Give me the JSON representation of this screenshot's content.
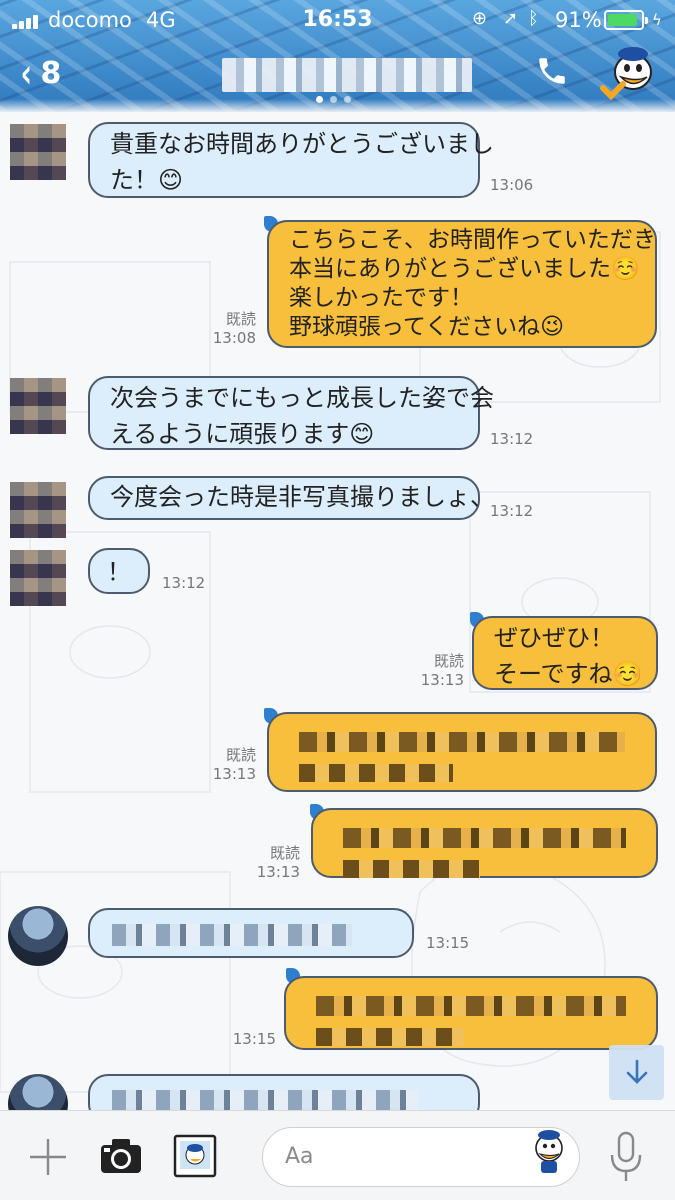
{
  "status_bar": {
    "carrier": "docomo",
    "network": "4G",
    "time": "16:53",
    "battery_percent_text": "91%",
    "battery_level": 0.91
  },
  "nav": {
    "back_count": "8",
    "icons": [
      "back-chevron-icon",
      "phone-icon",
      "menu-mascot-icon"
    ],
    "page_dots": 3,
    "active_dot": 0
  },
  "messages": [
    {
      "side": "left",
      "lines": [
        "貴重なお時間ありがとうございまし",
        "た！😊"
      ],
      "time": "13:06"
    },
    {
      "side": "right",
      "lines": [
        "こちらこそ、お時間作っていただき",
        "本当にありがとうございました☺️",
        "楽しかったです！",
        "野球頑張ってくださいね😉"
      ],
      "read": "既読",
      "time": "13:08"
    },
    {
      "side": "left",
      "lines": [
        "次会うまでにもっと成長した姿で会",
        "えるように頑張ります😊"
      ],
      "time": "13:12"
    },
    {
      "side": "left",
      "lines": [
        "今度会った時是非写真撮りましょ、"
      ],
      "time": "13:12"
    },
    {
      "side": "left",
      "lines": [
        "！"
      ],
      "time": "13:12"
    },
    {
      "side": "right",
      "lines": [
        "ぜひぜひ！",
        "そーですね☺️"
      ],
      "read": "既読",
      "time": "13:13"
    },
    {
      "side": "right",
      "redacted": true,
      "read": "既読",
      "time": "13:13"
    },
    {
      "side": "right",
      "redacted": true,
      "read": "既読",
      "time": "13:13"
    },
    {
      "side": "left",
      "redacted": true,
      "time": "13:15"
    },
    {
      "side": "right",
      "redacted": true,
      "time": "13:15"
    },
    {
      "side": "left",
      "redacted": true,
      "time": ""
    }
  ],
  "composer": {
    "placeholder": "Aa",
    "icons": [
      "plus-icon",
      "camera-icon",
      "photo-icon",
      "sticker-mascot-icon",
      "mic-icon"
    ]
  },
  "colors": {
    "left_bubble": "#dcedfb",
    "right_bubble": "#f7bf3b",
    "header": "#3d8fd0"
  }
}
